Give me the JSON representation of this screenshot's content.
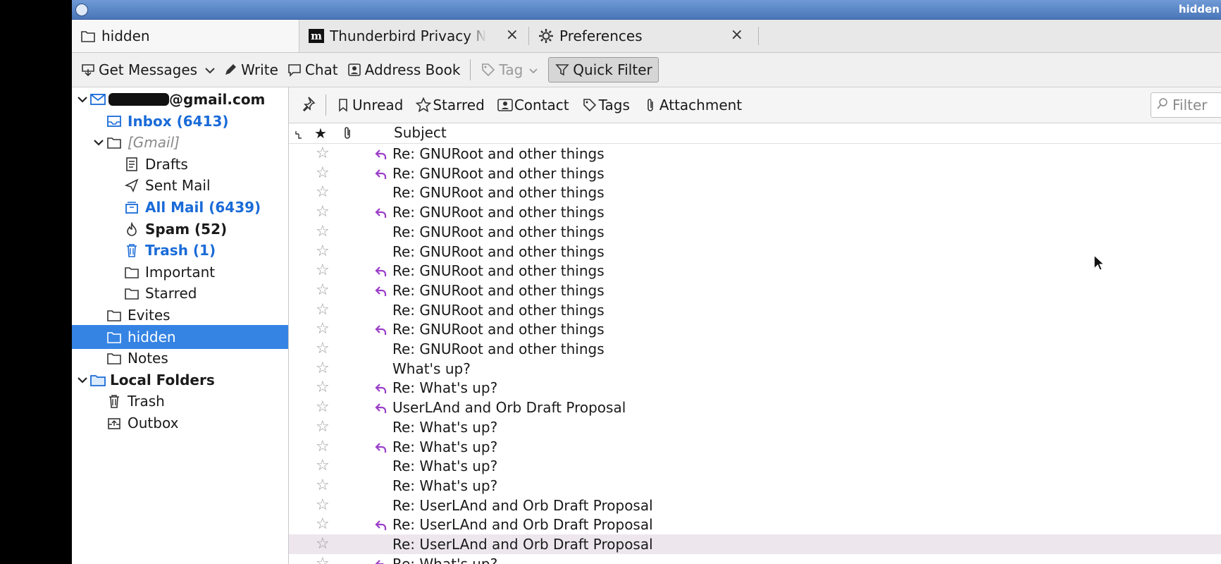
{
  "window": {
    "title": "hidden"
  },
  "tabs": [
    {
      "label": "hidden",
      "icon": "folder-icon",
      "active": true
    },
    {
      "label": "Thunderbird Privacy N",
      "icon": "mozilla-m-icon",
      "close": "×"
    },
    {
      "label": "Preferences",
      "icon": "gear-icon",
      "close": "×"
    }
  ],
  "toolbar": {
    "get_messages": "Get Messages",
    "write": "Write",
    "chat": "Chat",
    "address_book": "Address Book",
    "tag": "Tag",
    "quick_filter": "Quick Filter"
  },
  "folders": {
    "account": "@gmail.com",
    "inbox": "Inbox (6413)",
    "gmail": "[Gmail]",
    "drafts": "Drafts",
    "sent": "Sent Mail",
    "allmail": "All Mail (6439)",
    "spam": "Spam (52)",
    "trash": "Trash (1)",
    "important": "Important",
    "starred": "Starred",
    "evites": "Evites",
    "hidden": "hidden",
    "notes": "Notes",
    "local": "Local Folders",
    "local_trash": "Trash",
    "outbox": "Outbox"
  },
  "quickfilter": {
    "unread": "Unread",
    "starred": "Starred",
    "contact": "Contact",
    "tags": "Tags",
    "attachment": "Attachment",
    "filter_placeholder": "Filter"
  },
  "columns": {
    "subject": "Subject"
  },
  "messages": [
    {
      "subject": "Re: GNURoot and other things",
      "replied": true
    },
    {
      "subject": "Re: GNURoot and other things",
      "replied": true
    },
    {
      "subject": "Re: GNURoot and other things",
      "replied": false
    },
    {
      "subject": "Re: GNURoot and other things",
      "replied": true
    },
    {
      "subject": "Re: GNURoot and other things",
      "replied": false
    },
    {
      "subject": "Re: GNURoot and other things",
      "replied": false
    },
    {
      "subject": "Re: GNURoot and other things",
      "replied": true
    },
    {
      "subject": "Re: GNURoot and other things",
      "replied": true
    },
    {
      "subject": "Re: GNURoot and other things",
      "replied": false
    },
    {
      "subject": "Re: GNURoot and other things",
      "replied": true
    },
    {
      "subject": "Re: GNURoot and other things",
      "replied": false
    },
    {
      "subject": "What's up?",
      "replied": false
    },
    {
      "subject": "Re: What's up?",
      "replied": true
    },
    {
      "subject": "UserLAnd and Orb Draft Proposal",
      "replied": true
    },
    {
      "subject": "Re: What's up?",
      "replied": false
    },
    {
      "subject": "Re: What's up?",
      "replied": true
    },
    {
      "subject": "Re: What's up?",
      "replied": false
    },
    {
      "subject": "Re: What's up?",
      "replied": false
    },
    {
      "subject": "Re: UserLAnd and Orb Draft Proposal",
      "replied": false
    },
    {
      "subject": "Re: UserLAnd and Orb Draft Proposal",
      "replied": true
    },
    {
      "subject": "Re: UserLAnd and Orb Draft Proposal",
      "replied": false,
      "hover": true
    },
    {
      "subject": "Re: What's up?",
      "replied": true
    }
  ],
  "colors": {
    "accent": "#3584e4",
    "unread": "#1a6bd8",
    "reply_arrow": "#9b3ec9"
  }
}
